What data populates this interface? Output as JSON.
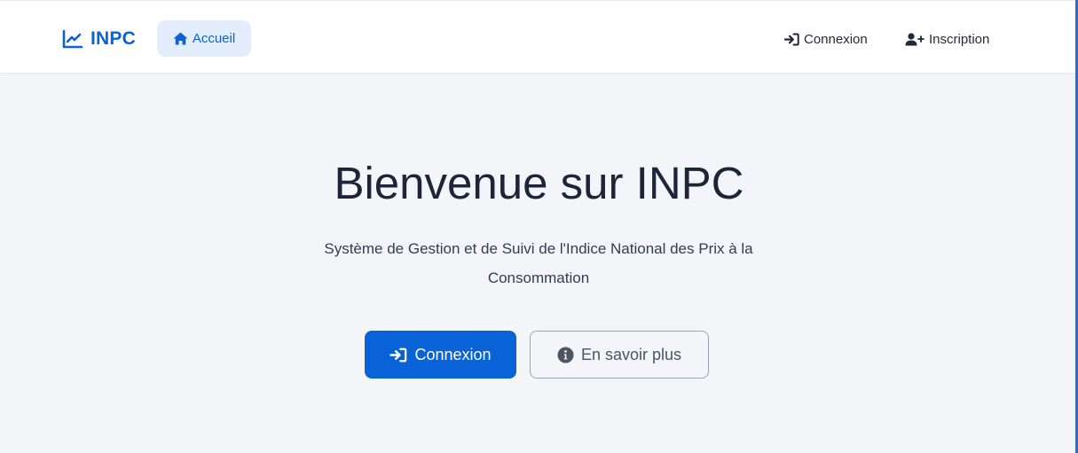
{
  "navbar": {
    "brand": {
      "text": "INPC",
      "icon": "chart-line-icon"
    },
    "home_link": {
      "label": "Accueil",
      "icon": "home-icon"
    },
    "login_link": {
      "label": "Connexion",
      "icon": "sign-in-icon"
    },
    "signup_link": {
      "label": "Inscription",
      "icon": "user-plus-icon"
    }
  },
  "hero": {
    "title": "Bienvenue sur INPC",
    "subtitle_line1": "Système de Gestion et de Suivi de l'Indice National des Prix à la",
    "subtitle_line2": "Consommation",
    "primary_button": {
      "label": "Connexion",
      "icon": "sign-in-icon"
    },
    "secondary_button": {
      "label": "En savoir plus",
      "icon": "info-circle-icon"
    }
  },
  "colors": {
    "accent": "#0a63d6",
    "page_background": "#f3f5f9",
    "navbar_background": "#ffffff",
    "home_pill_background": "#e3edfb"
  }
}
